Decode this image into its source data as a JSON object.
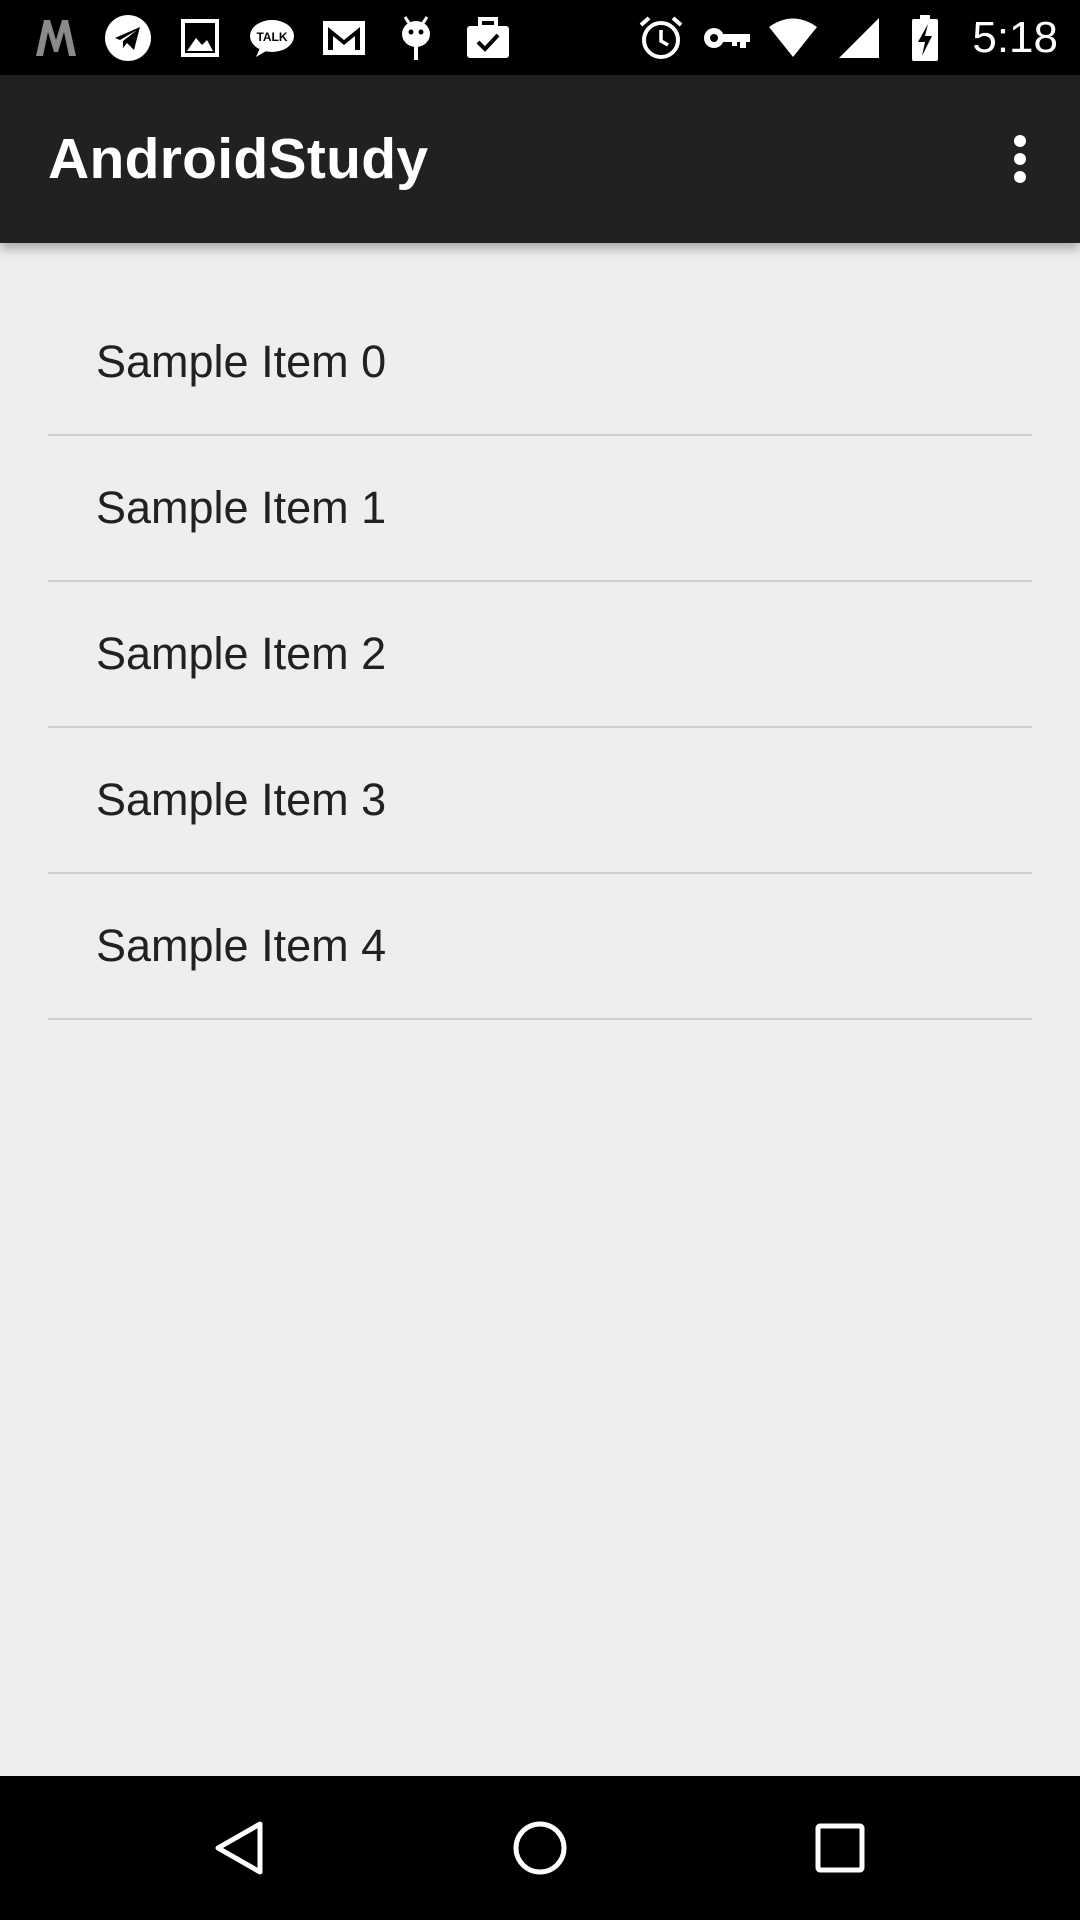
{
  "status_bar": {
    "time": "5:18",
    "left_icons": [
      "m-app-icon",
      "telegram-icon",
      "image-icon",
      "talk-icon",
      "gmail-icon",
      "android-debug-icon",
      "briefcase-check-icon"
    ],
    "right_icons": [
      "alarm-icon",
      "vpn-key-icon",
      "wifi-icon",
      "cell-signal-icon",
      "battery-charging-icon"
    ]
  },
  "app_bar": {
    "title": "AndroidStudy",
    "menu_icon": "overflow-menu-icon"
  },
  "list": {
    "items": [
      {
        "label": "Sample Item 0"
      },
      {
        "label": "Sample Item 1"
      },
      {
        "label": "Sample Item 2"
      },
      {
        "label": "Sample Item 3"
      },
      {
        "label": "Sample Item 4"
      }
    ]
  },
  "nav_bar": {
    "buttons": [
      "back-icon",
      "home-icon",
      "recents-icon"
    ]
  },
  "colors": {
    "status_bar_bg": "#000000",
    "app_bar_bg": "#212121",
    "content_bg": "#eeeeee",
    "divider": "#cfcfcf",
    "item_text": "#212121"
  }
}
